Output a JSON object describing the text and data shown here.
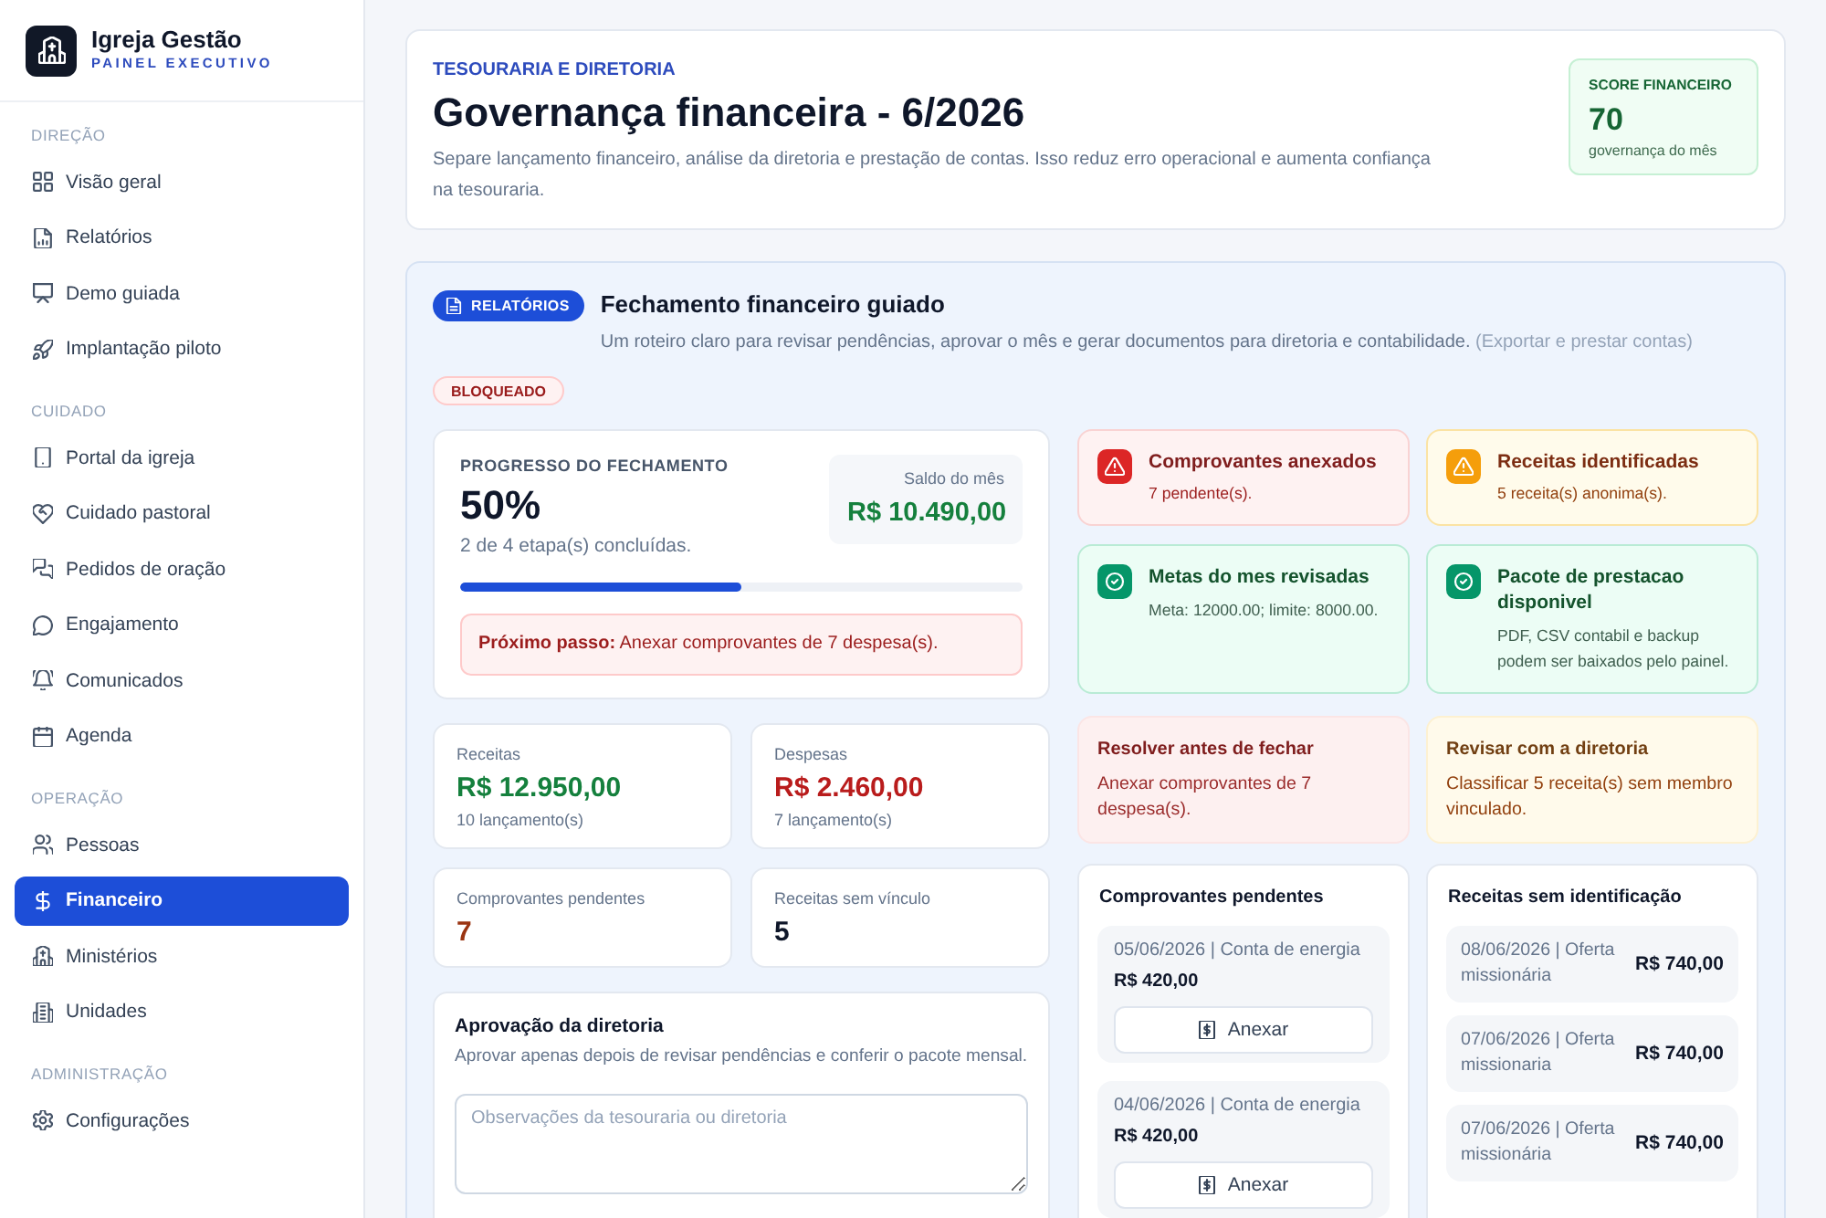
{
  "sidebar": {
    "brand": {
      "name": "Igreja Gestão",
      "subtitle": "PAINEL EXECUTIVO"
    },
    "sections": [
      {
        "label": "DIREÇÃO",
        "items": [
          {
            "label": "Visão geral",
            "selected": false
          },
          {
            "label": "Relatórios",
            "selected": false
          },
          {
            "label": "Demo guiada",
            "selected": false
          },
          {
            "label": "Implantação piloto",
            "selected": false
          }
        ]
      },
      {
        "label": "CUIDADO",
        "items": [
          {
            "label": "Portal da igreja",
            "selected": false
          },
          {
            "label": "Cuidado pastoral",
            "selected": false
          },
          {
            "label": "Pedidos de oração",
            "selected": false
          },
          {
            "label": "Engajamento",
            "selected": false
          },
          {
            "label": "Comunicados",
            "selected": false
          },
          {
            "label": "Agenda",
            "selected": false
          }
        ]
      },
      {
        "label": "OPERAÇÃO",
        "items": [
          {
            "label": "Pessoas",
            "selected": false
          },
          {
            "label": "Financeiro",
            "selected": true
          },
          {
            "label": "Ministérios",
            "selected": false
          },
          {
            "label": "Unidades",
            "selected": false
          }
        ]
      },
      {
        "label": "ADMINISTRAÇÃO",
        "items": [
          {
            "label": "Configurações",
            "selected": false
          }
        ]
      }
    ]
  },
  "header": {
    "eyebrow": "TESOURARIA E DIRETORIA",
    "title": "Governança financeira - 6/2026",
    "description": "Separe lançamento financeiro, análise da diretoria e prestação de contas. Isso reduz erro operacional e aumenta confiança na tesouraria.",
    "score": {
      "label": "SCORE FINANCEIRO",
      "value": "70",
      "caption": "governança do mês"
    }
  },
  "closing": {
    "tag": "RELATÓRIOS",
    "title": "Fechamento financeiro guiado",
    "subtitle": "Um roteiro claro para revisar pendências, aprovar o mês e gerar documentos para diretoria e contabilidade.",
    "subtitle_note": "(Exportar e prestar contas)",
    "status": "BLOQUEADO",
    "progress": {
      "label": "PROGRESSO DO FECHAMENTO",
      "percent": "50%",
      "steps": "2 de 4 etapa(s) concluídas.",
      "level": 0.5,
      "balance_label": "Saldo do mês",
      "balance": "R$ 10.490,00",
      "next_step": "**Próximo passo:** Anexar comprovantes de 7 despesa(s)."
    },
    "stats": [
      {
        "label": "Receitas",
        "value": "R$ 12.950,00",
        "caption": "10 lançamento(s)",
        "color": "#15803d"
      },
      {
        "label": "Despesas",
        "value": "R$ 2.460,00",
        "caption": "7 lançamento(s)",
        "color": "#b91c1c"
      },
      {
        "label": "Comprovantes pendentes",
        "value": "7",
        "color": "#9a3412"
      },
      {
        "label": "Receitas sem vínculo",
        "value": "5",
        "color": "#0f172a"
      }
    ],
    "approval": {
      "title": "Aprovação da diretoria",
      "description": "Aprovar apenas depois de revisar pendências e conferir o pacote mensal.",
      "notes": {
        "placeholder": "Observações da tesouraria ou diretoria"
      }
    },
    "checks": [
      {
        "title": "Comprovantes anexados",
        "detail": "7 pendente(s).",
        "kind": "danger"
      },
      {
        "title": "Receitas identificadas",
        "detail": "5 receita(s) anonima(s).",
        "kind": "warning"
      },
      {
        "title": "Metas do mes revisadas",
        "detail": "Meta: 12000.00; limite: 8000.00.",
        "kind": "done"
      },
      {
        "title": "Pacote de prestacao disponivel",
        "detail": "PDF, CSV contabil e backup podem ser baixados pelo painel.",
        "kind": "done"
      }
    ],
    "actions": [
      {
        "title": "Resolver antes de fechar",
        "text": "Anexar comprovantes de 7 despesa(s).",
        "kind": "danger"
      },
      {
        "title": "Revisar com a diretoria",
        "text": "Classificar 5 receita(s) sem membro vinculado.",
        "kind": "warning"
      }
    ],
    "pending_receipts": {
      "title": "Comprovantes pendentes",
      "items": [
        {
          "description": "05/06/2026 | Conta de energia",
          "amount": "R$ 420,00",
          "button": "Anexar"
        },
        {
          "description": "04/06/2026 | Conta de energia",
          "amount": "R$ 420,00",
          "button": "Anexar"
        }
      ]
    },
    "unidentified_income": {
      "title": "Receitas sem identificação",
      "items": [
        {
          "description": "08/06/2026 | Oferta missionária",
          "amount": "R$ 740,00"
        },
        {
          "description": "07/06/2026 | Oferta missionaria",
          "amount": "R$ 740,00"
        },
        {
          "description": "07/06/2026 | Oferta missionária",
          "amount": "R$ 740,00"
        }
      ]
    }
  }
}
